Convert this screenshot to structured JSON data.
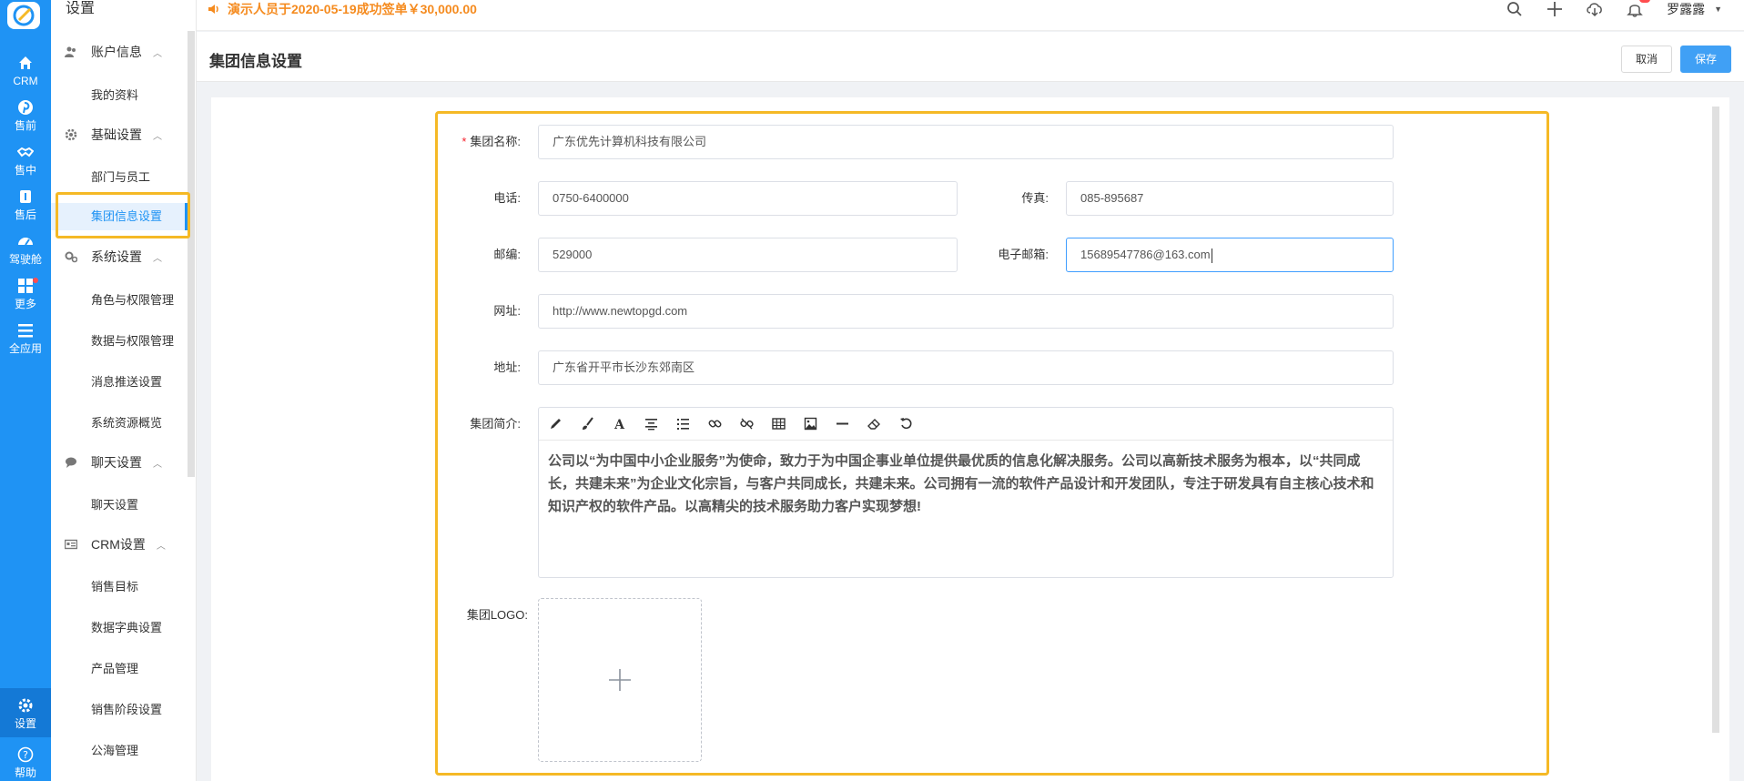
{
  "rail": {
    "items": [
      {
        "label": "CRM",
        "icon": "home-icon"
      },
      {
        "label": "售前",
        "icon": "pinterest-icon"
      },
      {
        "label": "售中",
        "icon": "handshake-icon"
      },
      {
        "label": "售后",
        "icon": "tools-icon"
      },
      {
        "label": "驾驶舱",
        "icon": "dashboard-icon"
      },
      {
        "label": "更多",
        "icon": "grid-icon"
      },
      {
        "label": "全应用",
        "icon": "menu-icon"
      },
      {
        "label": "设置",
        "icon": "gear-icon"
      },
      {
        "label": "帮助",
        "icon": "help-icon"
      }
    ]
  },
  "sidebar": {
    "title": "设置",
    "groups": [
      {
        "label": "账户信息",
        "items": [
          "我的资料"
        ]
      },
      {
        "label": "基础设置",
        "items": [
          "部门与员工",
          "集团信息设置"
        ]
      },
      {
        "label": "系统设置",
        "items": [
          "角色与权限管理",
          "数据与权限管理",
          "消息推送设置",
          "系统资源概览"
        ]
      },
      {
        "label": "聊天设置",
        "items": [
          "聊天设置"
        ]
      },
      {
        "label": "CRM设置",
        "items": [
          "销售目标",
          "数据字典设置",
          "产品管理",
          "销售阶段设置",
          "公海管理"
        ]
      }
    ],
    "active_item": "集团信息设置"
  },
  "topbar": {
    "notice": "演示人员于2020-05-19成功签单￥30,000.00",
    "user": "罗露露"
  },
  "page": {
    "title": "集团信息设置",
    "cancel_label": "取消",
    "save_label": "保存"
  },
  "form": {
    "name_label": "集团名称:",
    "name_value": "广东优先计算机科技有限公司",
    "phone_label": "电话:",
    "phone_value": "0750-6400000",
    "fax_label": "传真:",
    "fax_value": "085-895687",
    "zip_label": "邮编:",
    "zip_value": "529000",
    "email_label": "电子邮箱:",
    "email_value": "15689547786@163.com",
    "website_label": "网址:",
    "website_value": "http://www.newtopgd.com",
    "address_label": "地址:",
    "address_value": "广东省开平市长沙东郊南区",
    "intro_label": "集团简介:",
    "intro_value": "公司以“为中国中小企业服务”为使命，致力于为中国企事业单位提供最优质的信息化解决服务。公司以高新技术服务为根本，以“共同成长，共建未来”为企业文化宗旨，与客户共同成长，共建未来。公司拥有一流的软件产品设计和开发团队，专注于研发具有自主核心技术和知识产权的软件产品。以高精尖的技术服务助力客户实现梦想!",
    "logo_label": "集团LOGO:"
  },
  "colors": {
    "primary": "#1f93f4",
    "highlight": "#f5b926",
    "notice": "#f58b1f"
  }
}
